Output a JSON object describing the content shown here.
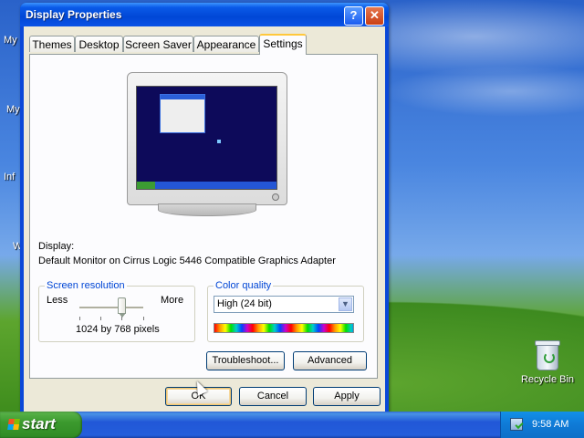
{
  "desktop": {
    "icon_labels": [
      "My",
      "My",
      "Inf",
      "W"
    ],
    "recycle_bin_label": "Recycle Bin"
  },
  "window": {
    "title": "Display Properties",
    "help_label": "?",
    "close_label": "✕",
    "tabs": [
      {
        "label": "Themes"
      },
      {
        "label": "Desktop"
      },
      {
        "label": "Screen Saver"
      },
      {
        "label": "Appearance"
      },
      {
        "label": "Settings",
        "active": true
      }
    ],
    "display": {
      "label": "Display:",
      "value": "Default Monitor on Cirrus Logic 5446 Compatible Graphics Adapter"
    },
    "screen_resolution": {
      "title": "Screen resolution",
      "less_label": "Less",
      "more_label": "More",
      "value": "1024 by 768 pixels",
      "slider_position": 0.6
    },
    "color_quality": {
      "title": "Color quality",
      "selected": "High (24 bit)"
    },
    "buttons": {
      "troubleshoot": "Troubleshoot...",
      "advanced": "Advanced",
      "ok": "OK",
      "cancel": "Cancel",
      "apply": "Apply"
    }
  },
  "taskbar": {
    "start_label": "start",
    "clock": "9:58 AM"
  },
  "colors": {
    "title_bar": "#0a5ae8",
    "dialog_bg": "#ece9d8",
    "group_title": "#0046d5",
    "start_button": "#3c9a2e",
    "taskbar": "#245edb"
  }
}
